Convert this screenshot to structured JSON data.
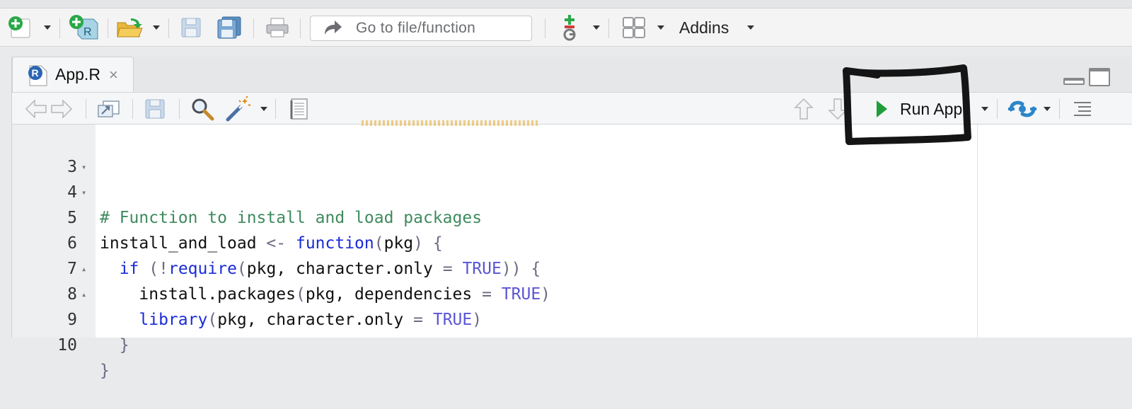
{
  "main_toolbar": {
    "goto_placeholder": "Go to file/function",
    "addins_label": "Addins"
  },
  "editor": {
    "tab_label": "App.R",
    "tab_close": "×",
    "run_app_label": "Run App",
    "lines": [
      {
        "num": "3",
        "fold": ""
      },
      {
        "num": "4",
        "fold": "▾"
      },
      {
        "num": "5",
        "fold": "▾"
      },
      {
        "num": "6",
        "fold": ""
      },
      {
        "num": "7",
        "fold": ""
      },
      {
        "num": "8",
        "fold": "▴"
      },
      {
        "num": "9",
        "fold": "▴"
      },
      {
        "num": "10",
        "fold": ""
      }
    ],
    "code_tokens": {
      "l3": {
        "comment": "# Function to install and load packages"
      },
      "l4": {
        "name": "install_and_load ",
        "assign": "<-",
        "sp": " ",
        "kw": "function",
        "open": "(",
        "arg": "pkg",
        "close": ")",
        "brace": " {"
      },
      "l5": {
        "indent": "  ",
        "kw": "if",
        "sp": " ",
        "open": "(",
        "bang": "!",
        "fn": "require",
        "open2": "(",
        "args": "pkg, character.only ",
        "eq": "=",
        "sp2": " ",
        "const": "TRUE",
        "close": "))",
        "brace": " {"
      },
      "l6": {
        "indent": "    ",
        "fn": "install.packages",
        "open": "(",
        "args": "pkg, dependencies ",
        "eq": "=",
        "sp": " ",
        "const": "TRUE",
        "close": ")"
      },
      "l7": {
        "indent": "    ",
        "fn": "library",
        "open": "(",
        "args": "pkg, character.only ",
        "eq": "=",
        "sp": " ",
        "const": "TRUE",
        "close": ")"
      },
      "l8": {
        "indent": "  ",
        "brace": "}"
      },
      "l9": {
        "brace": "}"
      }
    }
  },
  "colors": {
    "run_green": "#1f9d3a",
    "comment": "#3f8a5e",
    "keyword": "#1a2bd6",
    "constant": "#5a55d6"
  },
  "icons": [
    "new-file-icon",
    "new-project-icon",
    "open-folder-icon",
    "save-icon",
    "save-all-icon",
    "print-icon",
    "goto-arrow-icon",
    "vcs-icon",
    "panes-grid-icon",
    "back-arrow-icon",
    "forward-arrow-icon",
    "show-in-window-icon",
    "search-icon",
    "magic-wand-icon",
    "compile-report-icon",
    "up-arrow-icon",
    "down-arrow-icon",
    "play-icon",
    "publish-icon",
    "outline-icon",
    "r-logo-icon"
  ]
}
